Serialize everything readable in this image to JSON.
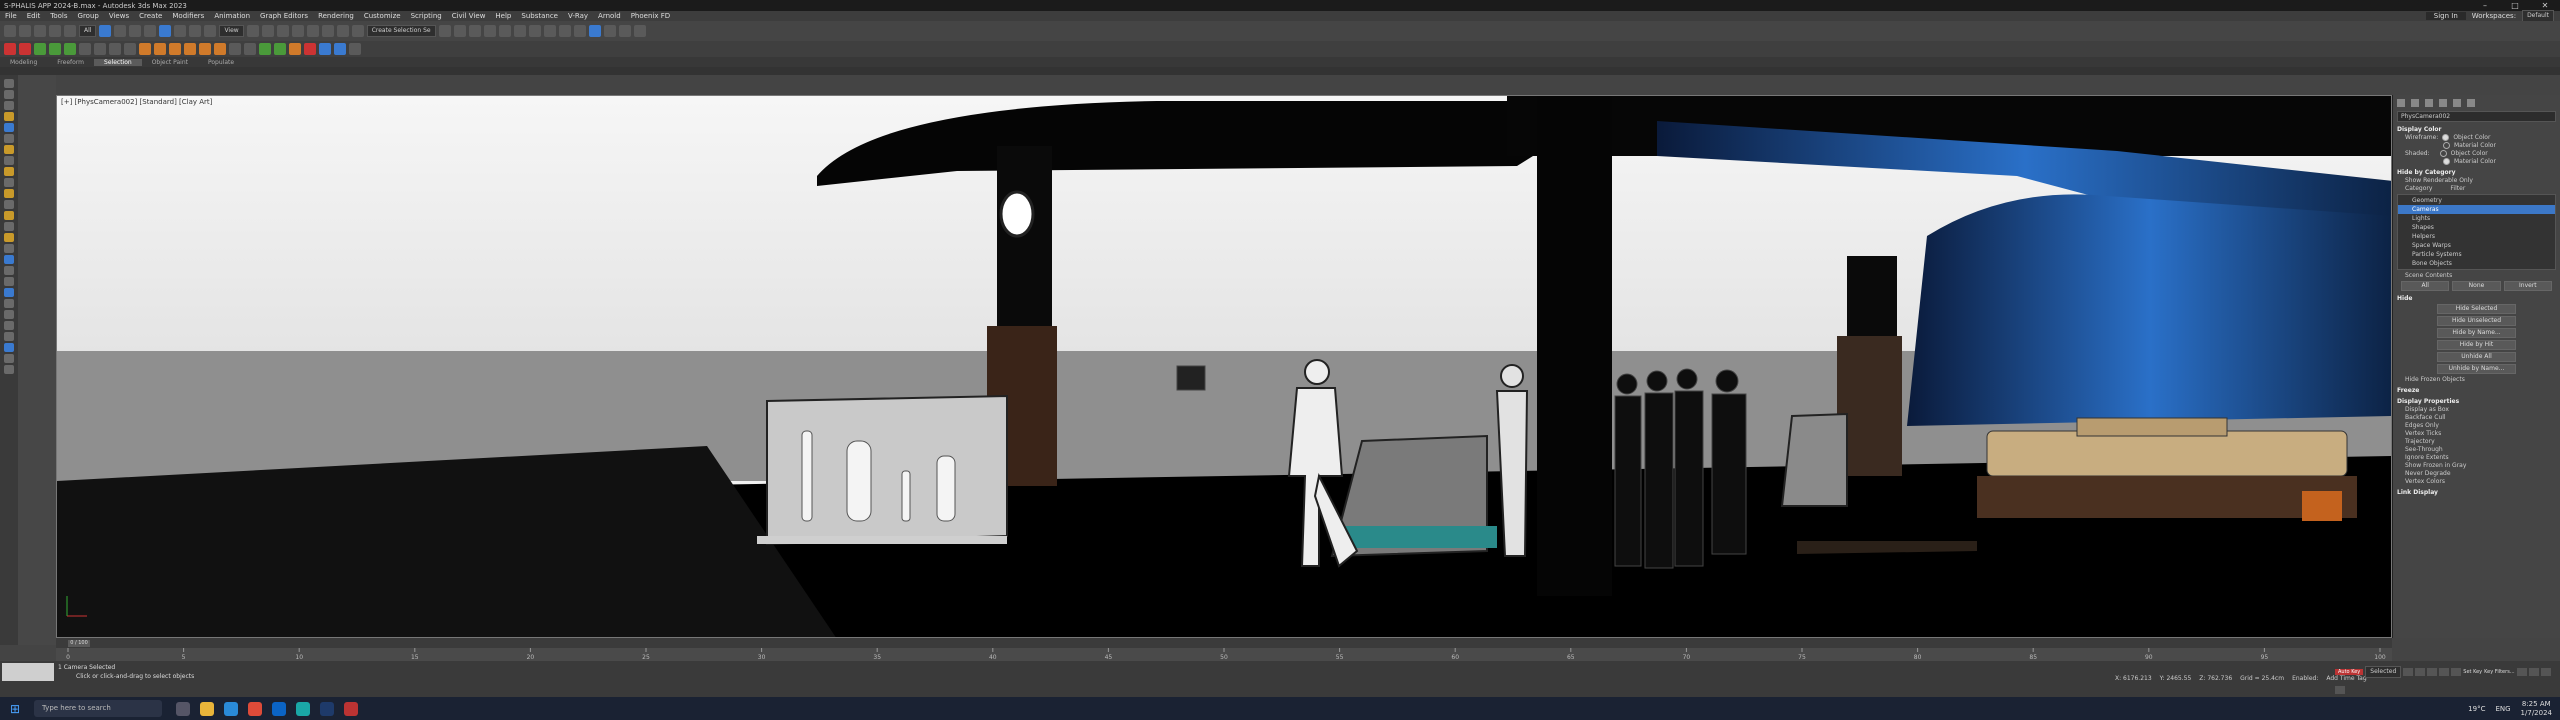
{
  "window": {
    "title": "S-PHALIS APP 2024-B.max - Autodesk 3ds Max 2023",
    "min": "–",
    "max": "□",
    "close": "✕"
  },
  "menu": [
    "File",
    "Edit",
    "Tools",
    "Group",
    "Views",
    "Create",
    "Modifiers",
    "Animation",
    "Graph Editors",
    "Rendering",
    "Customize",
    "Scripting",
    "Civil View",
    "Help",
    "Substance",
    "V-Ray",
    "Arnold",
    "Phoenix FD"
  ],
  "menu_right": {
    "sign_in": "Sign In",
    "workspaces_label": "Workspaces:",
    "workspace": "Default"
  },
  "toolbar": {
    "view_dropdown": "View",
    "selection_set": "Create Selection Se"
  },
  "ribbon_tabs": [
    "Modeling",
    "Freeform",
    "Selection",
    "Object Paint",
    "Populate"
  ],
  "ribbon_active": "Selection",
  "viewport": {
    "label": "[+] [PhysCamera002] [Standard] [Clay Art]"
  },
  "cmdpanel": {
    "object_name": "PhysCamera002",
    "display_color": "Display Color",
    "wireframe": "Wireframe:",
    "shaded": "Shaded:",
    "object_color": "Object Color",
    "material_color": "Material Color",
    "hide_by_category": "Hide by Category",
    "show_renderable": "Show Renderable Only",
    "category": "Category",
    "filter": "Filter",
    "categories": [
      "Geometry",
      "Cameras",
      "Lights",
      "Shapes",
      "Helpers",
      "Space Warps",
      "Particle Systems",
      "Bone Objects"
    ],
    "selected_category": "Cameras",
    "scene_contents": "Scene Contents",
    "all": "All",
    "none": "None",
    "invert": "Invert",
    "hide": "Hide",
    "hide_buttons": [
      "Hide Selected",
      "Hide Unselected",
      "Hide by Name...",
      "Hide by Hit",
      "Unhide All",
      "Unhide by Name...",
      "Hide Frozen Objects"
    ],
    "freeze": "Freeze",
    "display_properties": "Display Properties",
    "props": [
      "Display as Box",
      "Backface Cull",
      "Edges Only",
      "Vertex Ticks",
      "Trajectory",
      "See-Through",
      "Ignore Extents",
      "Show Frozen in Gray",
      "Never Degrade",
      "Vertex Colors"
    ],
    "link_display": "Link Display"
  },
  "timeline": {
    "frame": "0 / 100",
    "ticks": [
      "0",
      "5",
      "10",
      "15",
      "20",
      "25",
      "30",
      "35",
      "40",
      "45",
      "50",
      "55",
      "60",
      "65",
      "70",
      "75",
      "80",
      "85",
      "90",
      "95",
      "100"
    ]
  },
  "status": {
    "selected": "1 Camera Selected",
    "hint": "Click or click-and-drag to select objects",
    "x": "X: 6176.213",
    "y": "Y: 2465.55",
    "z": "Z: 762.736",
    "grid": "Grid = 25.4cm",
    "add_time_tag": "Add Time Tag",
    "enabled": "Enabled:",
    "auto_key": "Auto Key",
    "set_key": "Set Key",
    "selected_label": "Selected",
    "key_filters": "Key Filters..."
  },
  "taskbar": {
    "search": "Type here to search",
    "weather": "19°C",
    "lang": "ENG",
    "time": "8:25 AM",
    "date": "1/7/2024"
  }
}
